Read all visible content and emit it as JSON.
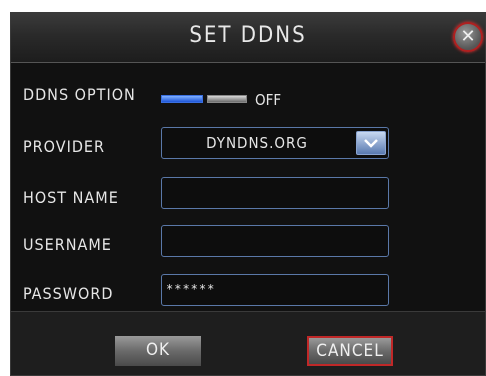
{
  "dialog": {
    "title": "SET DDNS"
  },
  "fields": {
    "ddns_option": {
      "label": "DDNS OPTION",
      "state": "OFF"
    },
    "provider": {
      "label": "PROVIDER",
      "value": "DYNDNS.ORG"
    },
    "host_name": {
      "label": "HOST NAME",
      "value": ""
    },
    "username": {
      "label": "USERNAME",
      "value": ""
    },
    "password": {
      "label": "PASSWORD",
      "value": "******"
    }
  },
  "buttons": {
    "ok": "OK",
    "cancel": "CANCEL"
  },
  "colors": {
    "toggle_on": "#1e55d8",
    "cancel_border": "#c02828",
    "close_border": "#b02020"
  }
}
